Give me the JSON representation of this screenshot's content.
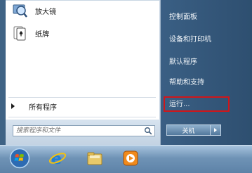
{
  "start_menu": {
    "pinned_programs": [
      {
        "label": "放大镜",
        "icon": "magnifier-icon"
      },
      {
        "label": "纸牌",
        "icon": "solitaire-icon"
      }
    ],
    "all_programs_label": "所有程序",
    "search": {
      "placeholder": "搜索程序和文件",
      "value": ""
    },
    "right_items": [
      {
        "label": "控制面板"
      },
      {
        "label": "设备和打印机"
      },
      {
        "label": "默认程序"
      },
      {
        "label": "帮助和支持"
      },
      {
        "label": "运行..."
      }
    ],
    "shutdown_label": "关机",
    "highlight_color": "#d0161a"
  },
  "taskbar": {
    "buttons": [
      {
        "icon": "windows-start-orb-icon"
      },
      {
        "icon": "internet-explorer-icon"
      },
      {
        "icon": "file-explorer-icon"
      },
      {
        "icon": "media-player-icon"
      }
    ]
  }
}
